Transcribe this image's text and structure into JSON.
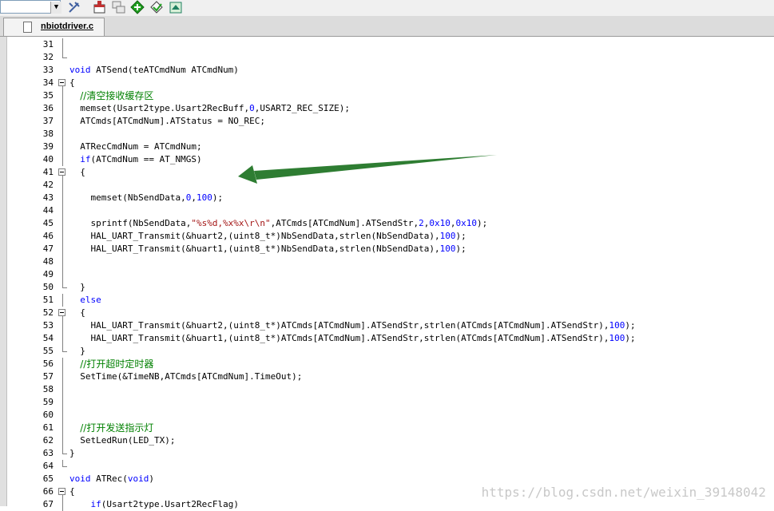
{
  "toolbar": {
    "buttons": [
      {
        "name": "tools-icon",
        "color": "#4060a0"
      },
      {
        "name": "window-icon",
        "color": "#c03030"
      },
      {
        "name": "window-tile-icon",
        "color": "#808080"
      },
      {
        "name": "add-icon",
        "color": "#20a020"
      },
      {
        "name": "bookmark-icon",
        "color": "#20a020"
      },
      {
        "name": "layers-icon",
        "color": "#208060"
      }
    ]
  },
  "tab": {
    "label": "nbiotdriver.c"
  },
  "colors": {
    "keyword": "#0000ff",
    "comment": "#008000",
    "string": "#a31515",
    "number": "#0000ff",
    "text": "#000000",
    "arrow": "#2e7d32",
    "watermark": "#c8c8c8"
  },
  "code_lines": [
    {
      "n": "31",
      "fold": "line",
      "tokens": []
    },
    {
      "n": "32",
      "fold": "end",
      "tokens": []
    },
    {
      "n": "33",
      "fold": "",
      "tokens": [
        {
          "t": "kw",
          "v": "void"
        },
        {
          "t": "txt",
          "v": " ATSend(teATCmdNum ATCmdNum)"
        }
      ]
    },
    {
      "n": "34",
      "fold": "box",
      "tokens": [
        {
          "t": "txt",
          "v": "{"
        }
      ]
    },
    {
      "n": "35",
      "fold": "line",
      "tokens": [
        {
          "t": "txt",
          "v": "  "
        },
        {
          "t": "cm",
          "v": "//清空接收缓存区"
        }
      ]
    },
    {
      "n": "36",
      "fold": "line",
      "tokens": [
        {
          "t": "txt",
          "v": "  memset(Usart2type.Usart2RecBuff,"
        },
        {
          "t": "num",
          "v": "0"
        },
        {
          "t": "txt",
          "v": ",USART2_REC_SIZE);"
        }
      ]
    },
    {
      "n": "37",
      "fold": "line",
      "tokens": [
        {
          "t": "txt",
          "v": "  ATCmds[ATCmdNum].ATStatus = NO_REC;"
        }
      ]
    },
    {
      "n": "38",
      "fold": "line",
      "tokens": []
    },
    {
      "n": "39",
      "fold": "line",
      "tokens": [
        {
          "t": "txt",
          "v": "  ATRecCmdNum = ATCmdNum;"
        }
      ]
    },
    {
      "n": "40",
      "fold": "line",
      "tokens": [
        {
          "t": "txt",
          "v": "  "
        },
        {
          "t": "kw",
          "v": "if"
        },
        {
          "t": "txt",
          "v": "(ATCmdNum == AT_NMGS)"
        }
      ]
    },
    {
      "n": "41",
      "fold": "box",
      "tokens": [
        {
          "t": "txt",
          "v": "  {"
        }
      ]
    },
    {
      "n": "42",
      "fold": "line",
      "tokens": []
    },
    {
      "n": "43",
      "fold": "line",
      "tokens": [
        {
          "t": "txt",
          "v": "    memset(NbSendData,"
        },
        {
          "t": "num",
          "v": "0"
        },
        {
          "t": "txt",
          "v": ","
        },
        {
          "t": "num",
          "v": "100"
        },
        {
          "t": "txt",
          "v": ");"
        }
      ]
    },
    {
      "n": "44",
      "fold": "line",
      "tokens": []
    },
    {
      "n": "45",
      "fold": "line",
      "tokens": [
        {
          "t": "txt",
          "v": "    sprintf(NbSendData,"
        },
        {
          "t": "str",
          "v": "\"%s%d,%x%x\\r\\n\""
        },
        {
          "t": "txt",
          "v": ",ATCmds[ATCmdNum].ATSendStr,"
        },
        {
          "t": "num",
          "v": "2"
        },
        {
          "t": "txt",
          "v": ","
        },
        {
          "t": "num",
          "v": "0x10"
        },
        {
          "t": "txt",
          "v": ","
        },
        {
          "t": "num",
          "v": "0x10"
        },
        {
          "t": "txt",
          "v": ");"
        }
      ]
    },
    {
      "n": "46",
      "fold": "line",
      "tokens": [
        {
          "t": "txt",
          "v": "    HAL_UART_Transmit(&huart2,(uint8_t*)NbSendData,strlen(NbSendData),"
        },
        {
          "t": "num",
          "v": "100"
        },
        {
          "t": "txt",
          "v": ");"
        }
      ]
    },
    {
      "n": "47",
      "fold": "line",
      "tokens": [
        {
          "t": "txt",
          "v": "    HAL_UART_Transmit(&huart1,(uint8_t*)NbSendData,strlen(NbSendData),"
        },
        {
          "t": "num",
          "v": "100"
        },
        {
          "t": "txt",
          "v": ");"
        }
      ]
    },
    {
      "n": "48",
      "fold": "line",
      "tokens": []
    },
    {
      "n": "49",
      "fold": "line",
      "tokens": []
    },
    {
      "n": "50",
      "fold": "end",
      "tokens": [
        {
          "t": "txt",
          "v": "  }"
        }
      ]
    },
    {
      "n": "51",
      "fold": "line",
      "tokens": [
        {
          "t": "txt",
          "v": "  "
        },
        {
          "t": "kw",
          "v": "else"
        }
      ]
    },
    {
      "n": "52",
      "fold": "box",
      "tokens": [
        {
          "t": "txt",
          "v": "  {"
        }
      ]
    },
    {
      "n": "53",
      "fold": "line",
      "tokens": [
        {
          "t": "txt",
          "v": "    HAL_UART_Transmit(&huart2,(uint8_t*)ATCmds[ATCmdNum].ATSendStr,strlen(ATCmds[ATCmdNum].ATSendStr),"
        },
        {
          "t": "num",
          "v": "100"
        },
        {
          "t": "txt",
          "v": ");"
        }
      ]
    },
    {
      "n": "54",
      "fold": "line",
      "tokens": [
        {
          "t": "txt",
          "v": "    HAL_UART_Transmit(&huart1,(uint8_t*)ATCmds[ATCmdNum].ATSendStr,strlen(ATCmds[ATCmdNum].ATSendStr),"
        },
        {
          "t": "num",
          "v": "100"
        },
        {
          "t": "txt",
          "v": ");"
        }
      ]
    },
    {
      "n": "55",
      "fold": "end",
      "tokens": [
        {
          "t": "txt",
          "v": "  }"
        }
      ]
    },
    {
      "n": "56",
      "fold": "line",
      "tokens": [
        {
          "t": "txt",
          "v": "  "
        },
        {
          "t": "cm",
          "v": "//打开超时定时器"
        }
      ]
    },
    {
      "n": "57",
      "fold": "line",
      "tokens": [
        {
          "t": "txt",
          "v": "  SetTime(&TimeNB,ATCmds[ATCmdNum].TimeOut);"
        }
      ]
    },
    {
      "n": "58",
      "fold": "line",
      "tokens": []
    },
    {
      "n": "59",
      "fold": "line",
      "tokens": []
    },
    {
      "n": "60",
      "fold": "line",
      "tokens": []
    },
    {
      "n": "61",
      "fold": "line",
      "tokens": [
        {
          "t": "txt",
          "v": "  "
        },
        {
          "t": "cm",
          "v": "//打开发送指示灯"
        }
      ]
    },
    {
      "n": "62",
      "fold": "line",
      "tokens": [
        {
          "t": "txt",
          "v": "  SetLedRun(LED_TX);"
        }
      ]
    },
    {
      "n": "63",
      "fold": "end",
      "tokens": [
        {
          "t": "txt",
          "v": "}"
        }
      ]
    },
    {
      "n": "64",
      "fold": "end",
      "tokens": []
    },
    {
      "n": "65",
      "fold": "",
      "tokens": [
        {
          "t": "kw",
          "v": "void"
        },
        {
          "t": "txt",
          "v": " ATRec("
        },
        {
          "t": "kw",
          "v": "void"
        },
        {
          "t": "txt",
          "v": ")"
        }
      ]
    },
    {
      "n": "66",
      "fold": "box",
      "tokens": [
        {
          "t": "txt",
          "v": "{"
        }
      ]
    },
    {
      "n": "67",
      "fold": "line",
      "tokens": [
        {
          "t": "txt",
          "v": "    "
        },
        {
          "t": "kw",
          "v": "if"
        },
        {
          "t": "txt",
          "v": "(Usart2type.Usart2RecFlag)"
        }
      ]
    }
  ],
  "watermark": "https://blog.csdn.net/weixin_39148042"
}
